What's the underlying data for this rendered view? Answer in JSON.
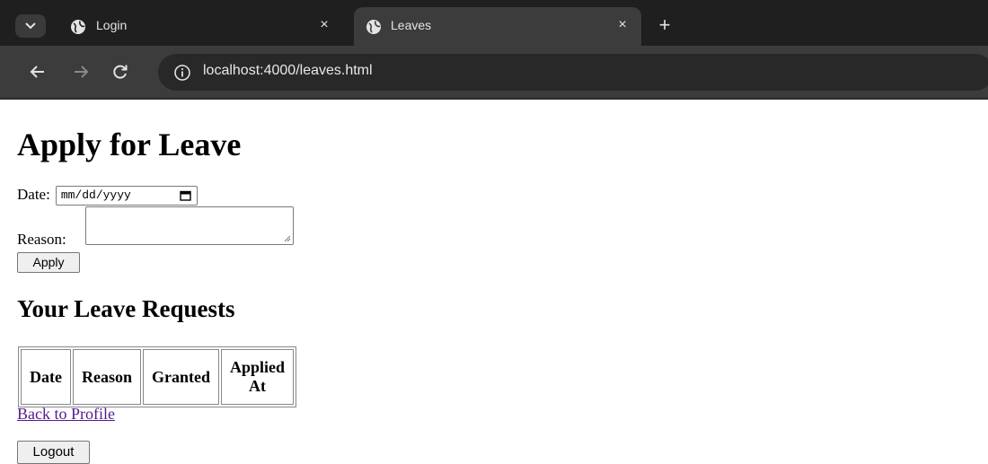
{
  "browser": {
    "tabs": [
      {
        "title": "Login",
        "active": false
      },
      {
        "title": "Leaves",
        "active": true
      }
    ],
    "close_glyph": "×",
    "new_tab_glyph": "+",
    "url": "localhost:4000/leaves.html",
    "icons": {
      "tab_menu": "chevron-down-icon",
      "tab_favicon": "globe-icon",
      "back": "back-arrow-icon",
      "forward": "forward-arrow-icon",
      "reload": "reload-icon",
      "site_info": "info-icon"
    }
  },
  "page": {
    "title": "Apply for Leave",
    "form": {
      "date_label": "Date:",
      "date_placeholder": "mm/dd/yyyy",
      "reason_label": "Reason:",
      "reason_value": "",
      "apply_label": "Apply"
    },
    "requests": {
      "title": "Your Leave Requests",
      "columns": [
        "Date",
        "Reason",
        "Granted",
        "Applied At"
      ],
      "rows": []
    },
    "back_link": "Back to Profile",
    "logout_label": "Logout"
  },
  "colors": {
    "visited_link": "#551a8b",
    "chrome_dark": "#1f1f1f",
    "toolbar": "#3c3c3c"
  }
}
